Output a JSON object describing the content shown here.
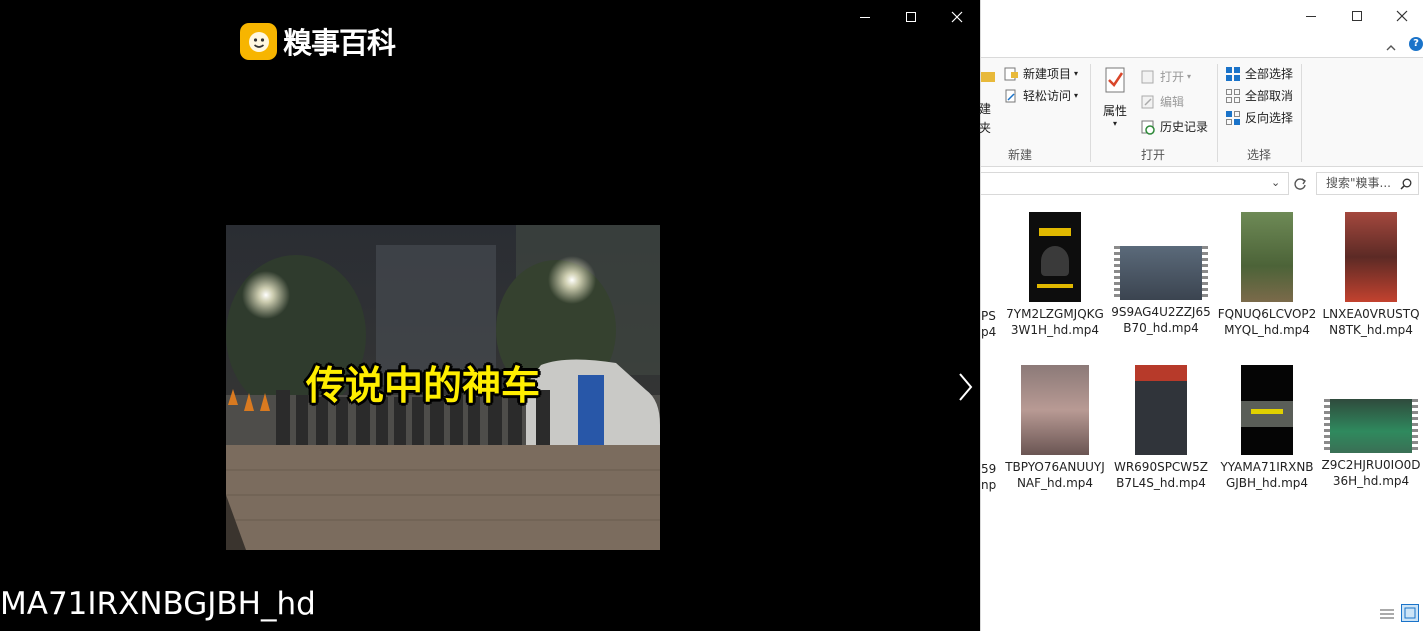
{
  "player": {
    "logo_text": "糗事百科",
    "caption": "传说中的神车",
    "filename": "MA71IRXNBGJBH_hd"
  },
  "explorer": {
    "ribbon": {
      "new_item": "新建项目",
      "easy_access": "轻松访问",
      "new_folder_partial_1": "建",
      "new_folder_partial_2": "夹",
      "properties": "属性",
      "open": "打开",
      "edit": "编辑",
      "history": "历史记录",
      "select_all": "全部选择",
      "select_none": "全部取消",
      "invert_select": "反向选择",
      "group_new": "新建",
      "group_open": "打开",
      "group_select": "选择"
    },
    "search_placeholder": "搜索\"糗事...",
    "partial_labels": [
      {
        "l1": "PS",
        "l2": "p4"
      },
      {
        "l1": "59",
        "l2": "np"
      }
    ],
    "files": [
      {
        "name": "7YM2LZGMJQKG3W1H_hd.mp4"
      },
      {
        "name": "9S9AG4U2ZZJ65B70_hd.mp4"
      },
      {
        "name": "FQNUQ6LCVOP2MYQL_hd.mp4"
      },
      {
        "name": "LNXEA0VRUSTQN8TK_hd.mp4"
      },
      {
        "name": "TBPYO76ANUUYJNAF_hd.mp4"
      },
      {
        "name": "WR690SPCW5ZB7L4S_hd.mp4"
      },
      {
        "name": "YYAMA71IRXNBGJBH_hd.mp4"
      },
      {
        "name": "Z9C2HJRU0IO0D36H_hd.mp4"
      }
    ]
  },
  "colors": {
    "caption_yellow": "#ffee00",
    "logo_orange": "#f7b500",
    "accent_blue": "#1a73c9"
  }
}
